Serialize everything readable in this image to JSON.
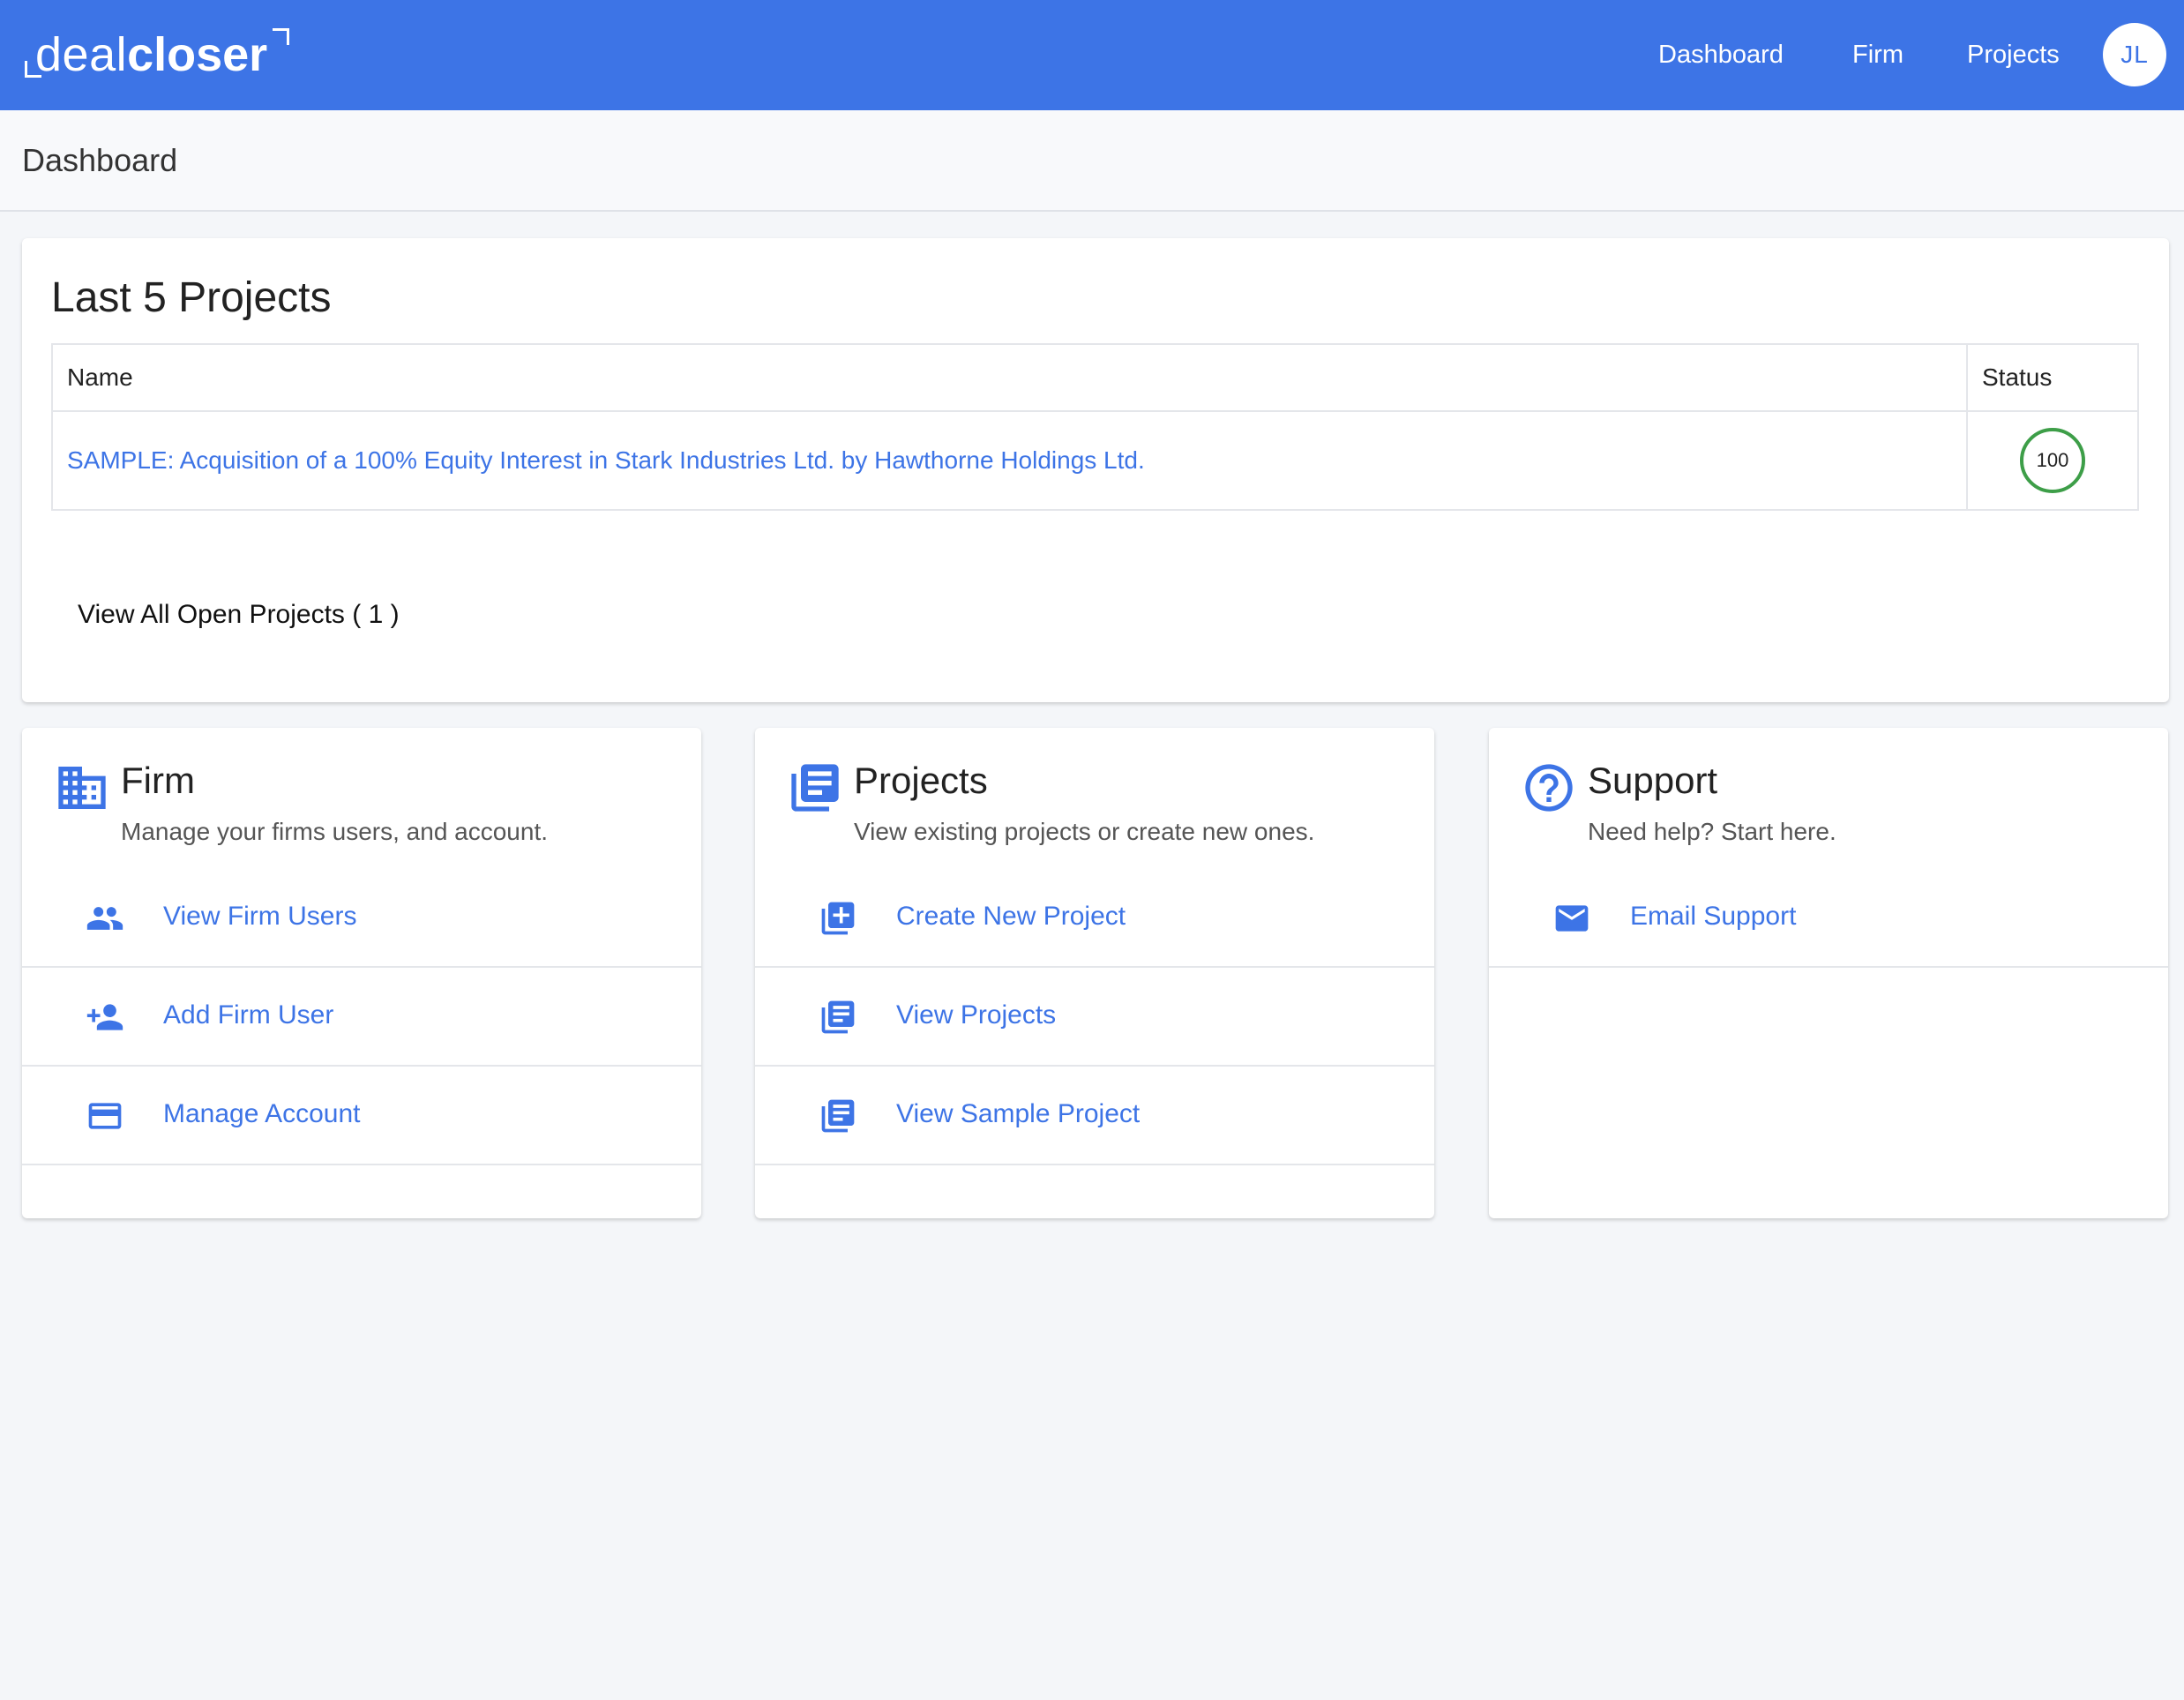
{
  "header": {
    "logo_light": "deal",
    "logo_bold": "closer",
    "nav": [
      "Dashboard",
      "Firm",
      "Projects"
    ],
    "avatar_initials": "JL"
  },
  "subheader": {
    "title": "Dashboard"
  },
  "last_projects": {
    "title": "Last 5 Projects",
    "columns": [
      "Name",
      "Status"
    ],
    "rows": [
      {
        "name": "SAMPLE: Acquisition of a 100% Equity Interest in Stark Industries Ltd. by Hawthorne Holdings Ltd.",
        "status": "100"
      }
    ],
    "view_all": "View All Open Projects ( 1 )"
  },
  "cards": {
    "firm": {
      "title": "Firm",
      "description": "Manage your firms users, and account.",
      "actions": [
        "View Firm Users",
        "Add Firm User",
        "Manage Account"
      ]
    },
    "projects": {
      "title": "Projects",
      "description": "View existing projects or create new ones.",
      "actions": [
        "Create New Project",
        "View Projects",
        "View Sample Project"
      ]
    },
    "support": {
      "title": "Support",
      "description": "Need help? Start here.",
      "actions": [
        "Email Support"
      ]
    }
  },
  "colors": {
    "brand": "#3d74e6",
    "status_ring": "#3d9e48",
    "background": "#f4f6f9"
  }
}
